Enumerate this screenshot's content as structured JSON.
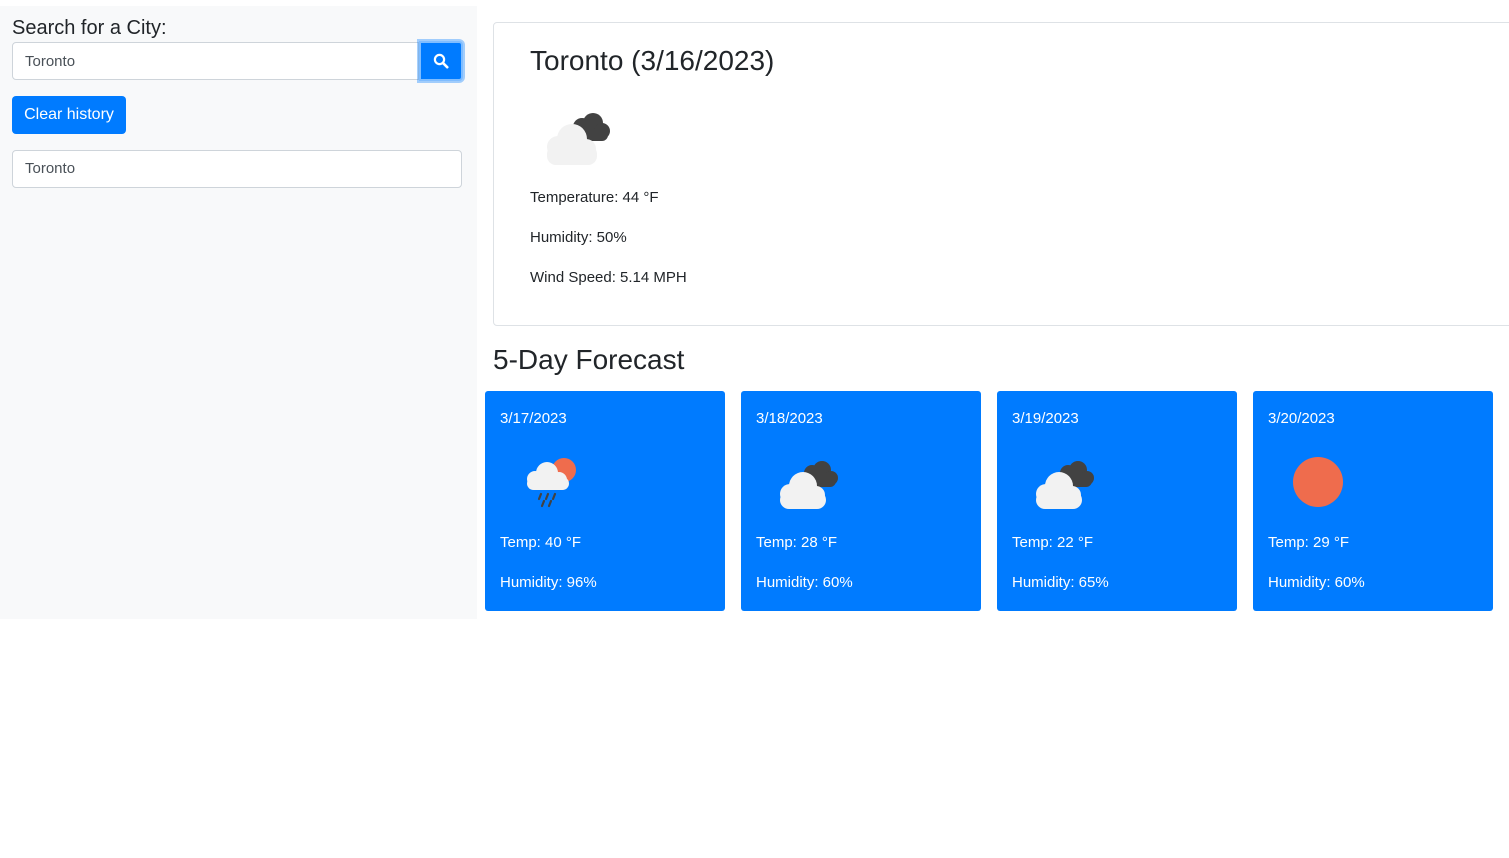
{
  "sidebar": {
    "search_label": "Search for a City:",
    "search_value": "Toronto",
    "search_icon": "search-icon",
    "clear_label": "Clear history",
    "history": [
      "Toronto"
    ]
  },
  "current": {
    "title": "Toronto (3/16/2023)",
    "icon": "broken-clouds-icon",
    "temperature": "Temperature: 44 °F",
    "humidity": "Humidity: 50%",
    "wind": "Wind Speed: 5.14 MPH"
  },
  "forecast": {
    "heading": "5-Day Forecast",
    "days": [
      {
        "date": "3/17/2023",
        "icon": "rain-icon",
        "temp": "Temp: 40 °F",
        "humidity": "Humidity: 96%"
      },
      {
        "date": "3/18/2023",
        "icon": "broken-clouds-icon",
        "temp": "Temp: 28 °F",
        "humidity": "Humidity: 60%"
      },
      {
        "date": "3/19/2023",
        "icon": "broken-clouds-icon",
        "temp": "Temp: 22 °F",
        "humidity": "Humidity: 65%"
      },
      {
        "date": "3/20/2023",
        "icon": "clear-sky-icon",
        "temp": "Temp: 29 °F",
        "humidity": "Humidity: 60%"
      }
    ]
  },
  "colors": {
    "primary": "#007bff",
    "sidebar_bg": "#f8f9fa",
    "sun": "#ef6c4d",
    "dark_cloud": "#424242",
    "light_cloud": "#f2f2f2"
  }
}
